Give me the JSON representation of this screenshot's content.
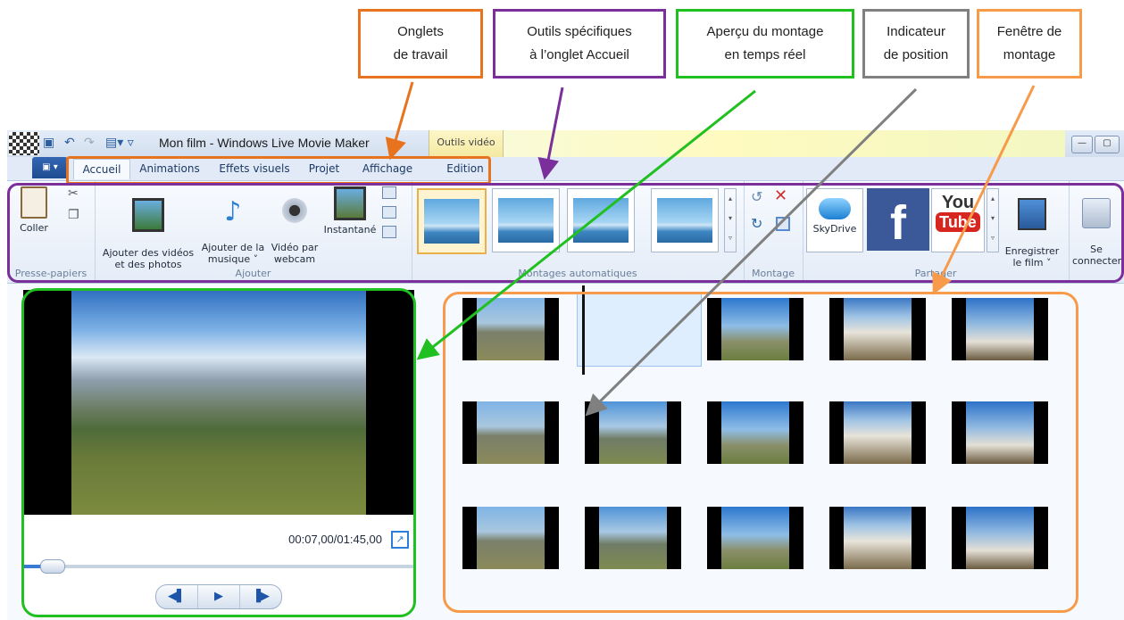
{
  "callouts": [
    {
      "text": "Onglets\nde travail",
      "color": "#e8731f"
    },
    {
      "text": "Outils spécifiques\nà l’onglet Accueil",
      "color": "#7a2f9a"
    },
    {
      "text": "Aperçu du montage\nen temps réel",
      "color": "#1fc01f"
    },
    {
      "text": "Indicateur\nde position",
      "color": "#808080"
    },
    {
      "text": "Fenêtre de\nmontage",
      "color": "#f79a4a"
    }
  ],
  "window": {
    "title": "Mon film - Windows Live Movie Maker",
    "context_tab": "Outils vidéo"
  },
  "tabs": [
    "Accueil",
    "Animations",
    "Effets visuels",
    "Projet",
    "Affichage",
    "Edition"
  ],
  "ribbon": {
    "clipboard": {
      "paste": "Coller",
      "group": "Presse-papiers"
    },
    "add": {
      "videos": "Ajouter des vidéos\net des photos",
      "music": "Ajouter de la\nmusique ˅",
      "webcam": "Vidéo par\nwebcam",
      "snapshot": "Instantané",
      "group": "Ajouter"
    },
    "automovie": {
      "group": "Montages automatiques"
    },
    "edit": {
      "group": "Montage"
    },
    "share": {
      "skydrive": "SkyDrive",
      "youtube": "You\nTube",
      "save": "Enregistrer\nle film ˅",
      "group": "Partager"
    },
    "signin": {
      "label": "Se\nconnecter"
    }
  },
  "preview": {
    "timecode": "00:07,00/01:45,00",
    "progress": 0.067
  },
  "storyboard": {
    "clips": 15,
    "selected": 1
  },
  "colors": {
    "orange": "#e8731f",
    "purple": "#7a2f9a",
    "green": "#1fc01f",
    "gray": "#808080",
    "lightorange": "#f79a4a"
  }
}
